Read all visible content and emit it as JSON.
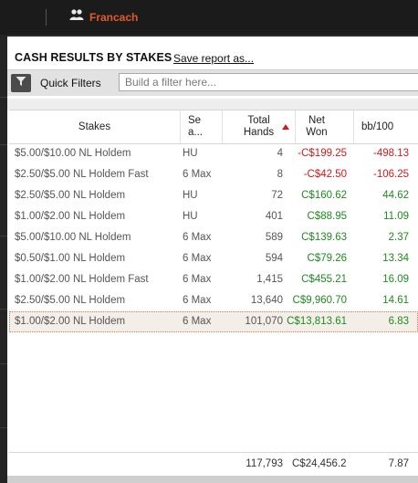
{
  "topbar": {
    "user_name": "Francach"
  },
  "report": {
    "title": "CASH RESULTS BY STAKES",
    "save_label": "Save report as..."
  },
  "quick_filters": {
    "label": "Quick Filters",
    "placeholder": "Build a filter here..."
  },
  "table": {
    "columns": {
      "stakes": "Stakes",
      "seats": "Se a...",
      "hands": "Total Hands",
      "net_won": "Net Won",
      "bb100": "bb/100"
    },
    "sort": {
      "column": "Total Hands",
      "direction": "ascending"
    },
    "rows": [
      {
        "stakes": "$5.00/$10.00 NL Holdem",
        "seats": "HU",
        "hands": "4",
        "net_won": "-C$199.25",
        "bb100": "-498.13",
        "sign": "neg"
      },
      {
        "stakes": "$2.50/$5.00 NL Holdem Fast",
        "seats": "6 Max",
        "hands": "8",
        "net_won": "-C$42.50",
        "bb100": "-106.25",
        "sign": "neg"
      },
      {
        "stakes": "$2.50/$5.00 NL Holdem",
        "seats": "HU",
        "hands": "72",
        "net_won": "C$160.62",
        "bb100": "44.62",
        "sign": "pos"
      },
      {
        "stakes": "$1.00/$2.00 NL Holdem",
        "seats": "HU",
        "hands": "401",
        "net_won": "C$88.95",
        "bb100": "11.09",
        "sign": "pos"
      },
      {
        "stakes": "$5.00/$10.00 NL Holdem",
        "seats": "6 Max",
        "hands": "589",
        "net_won": "C$139.63",
        "bb100": "2.37",
        "sign": "pos"
      },
      {
        "stakes": "$0.50/$1.00 NL Holdem",
        "seats": "6 Max",
        "hands": "594",
        "net_won": "C$79.26",
        "bb100": "13.34",
        "sign": "pos"
      },
      {
        "stakes": "$1.00/$2.00 NL Holdem Fast",
        "seats": "6 Max",
        "hands": "1,415",
        "net_won": "C$455.21",
        "bb100": "16.09",
        "sign": "pos"
      },
      {
        "stakes": "$2.50/$5.00 NL Holdem",
        "seats": "6 Max",
        "hands": "13,640",
        "net_won": "C$9,960.70",
        "bb100": "14.61",
        "sign": "pos"
      },
      {
        "stakes": "$1.00/$2.00 NL Holdem",
        "seats": "6 Max",
        "hands": "101,070",
        "net_won": "C$13,813.61",
        "bb100": "6.83",
        "sign": "pos",
        "selected": true
      }
    ],
    "totals": {
      "hands": "117,793",
      "net_won": "C$24,456.2",
      "bb100": "7.87"
    }
  },
  "colors": {
    "negative": "#d01b1b",
    "positive": "#1f8a1f",
    "accent": "#e35a2a"
  },
  "icons": {
    "user": "users-icon",
    "filter": "funnel-icon",
    "sort": "sort-up-icon"
  }
}
